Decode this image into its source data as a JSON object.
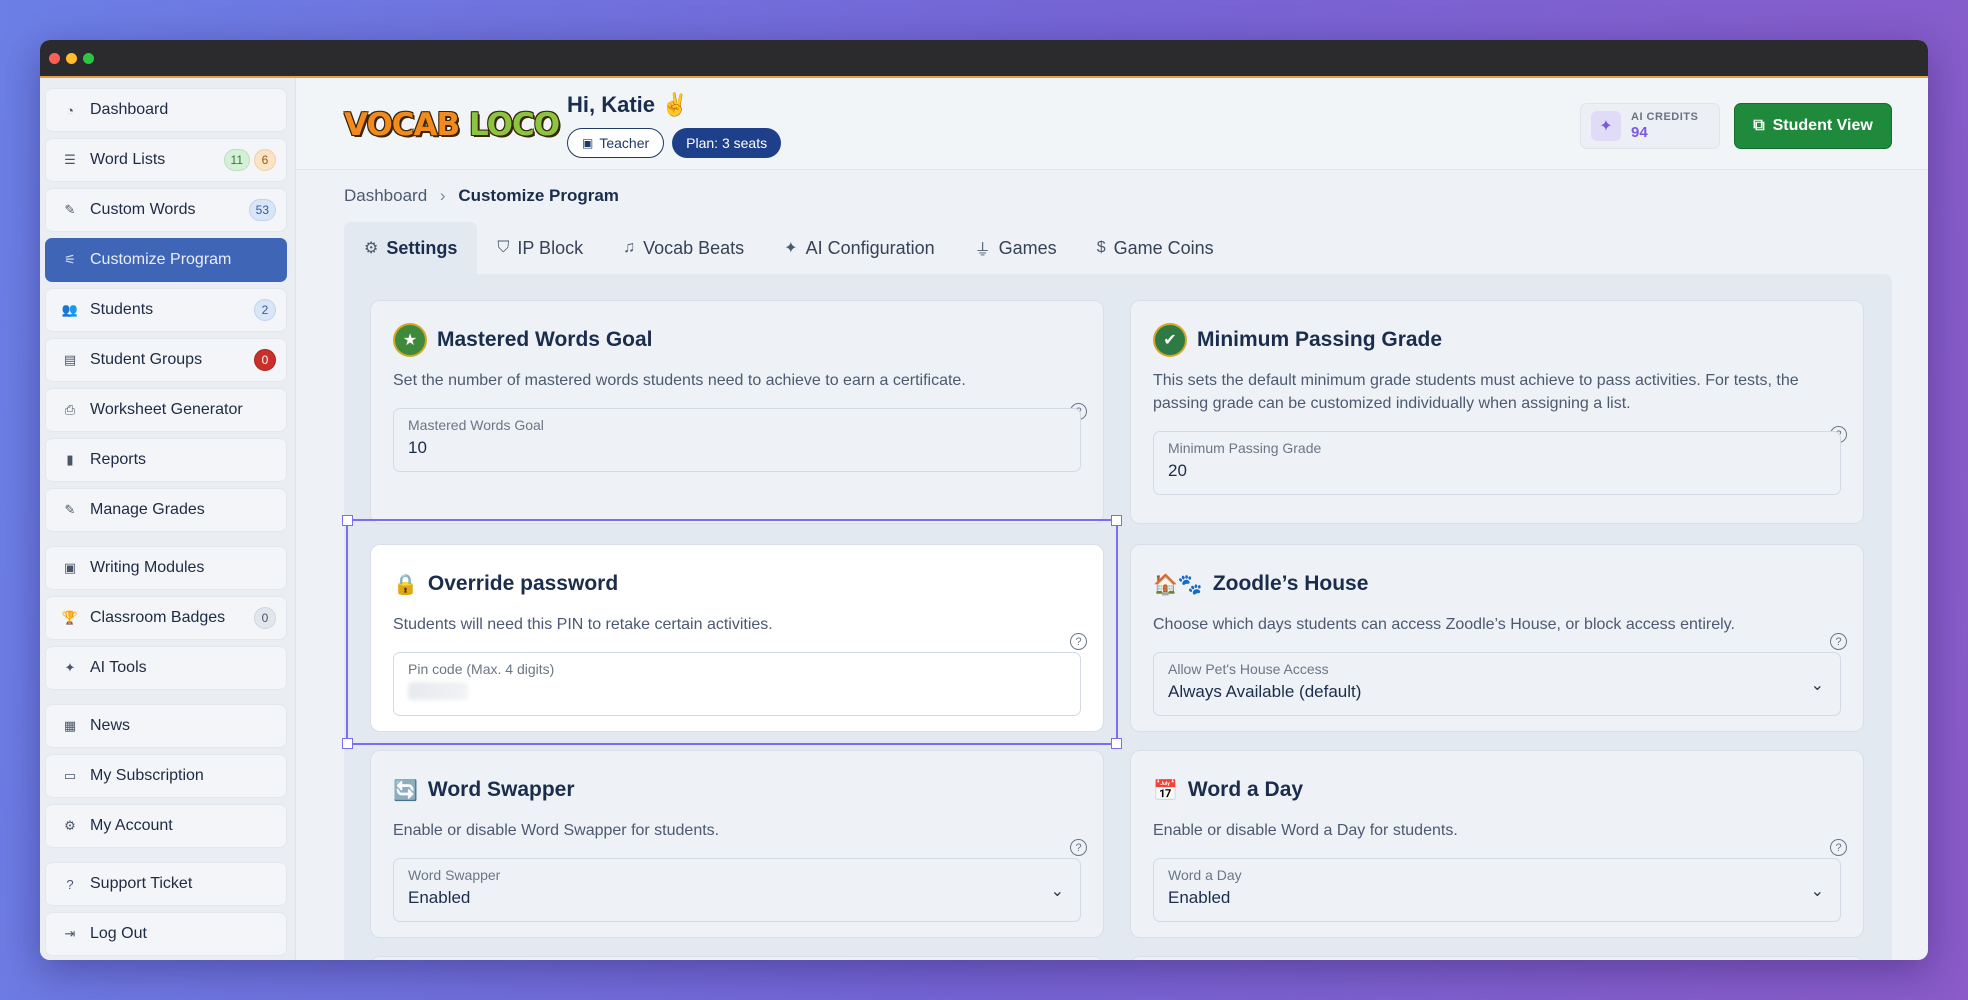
{
  "sidebar": {
    "items": [
      {
        "label": "Dashboard",
        "icon": "gauge-icon"
      },
      {
        "label": "Word Lists",
        "icon": "list-icon",
        "badges": [
          "11",
          "6"
        ]
      },
      {
        "label": "Custom Words",
        "icon": "edit-icon",
        "badges": [
          "53"
        ]
      },
      {
        "label": "Customize Program",
        "icon": "sliders-icon"
      },
      {
        "label": "Students",
        "icon": "users-icon",
        "badges": [
          "2"
        ]
      },
      {
        "label": "Student Groups",
        "icon": "folder-icon",
        "badges": [
          "0"
        ]
      },
      {
        "label": "Worksheet Generator",
        "icon": "printer-icon"
      },
      {
        "label": "Reports",
        "icon": "bar-chart-icon"
      },
      {
        "label": "Manage Grades",
        "icon": "edit-icon"
      },
      {
        "label": "Writing Modules",
        "icon": "image-icon"
      },
      {
        "label": "Classroom Badges",
        "icon": "trophy-icon",
        "badges": [
          "0"
        ]
      },
      {
        "label": "AI Tools",
        "icon": "sparkle-icon"
      },
      {
        "label": "News",
        "icon": "newspaper-icon"
      },
      {
        "label": "My Subscription",
        "icon": "credit-card-icon"
      },
      {
        "label": "My Account",
        "icon": "gear-icon"
      },
      {
        "label": "Support Ticket",
        "icon": "question-icon"
      },
      {
        "label": "Log Out",
        "icon": "logout-icon"
      }
    ]
  },
  "header": {
    "logo_word1": "VOCAB",
    "logo_word2": "LOCO",
    "greeting": "Hi, Katie ✌️",
    "role": "Teacher",
    "plan": "Plan: 3 seats",
    "credits_label": "AI CREDITS",
    "credits_value": "94",
    "student_view": "Student View"
  },
  "breadcrumb": {
    "root": "Dashboard",
    "sep": "›",
    "current": "Customize Program"
  },
  "tabs": [
    {
      "label": "Settings",
      "icon": "gear-icon",
      "active": true
    },
    {
      "label": "IP Block",
      "icon": "shield-icon"
    },
    {
      "label": "Vocab Beats",
      "icon": "music-note-icon"
    },
    {
      "label": "AI Configuration",
      "icon": "sparkle-icon"
    },
    {
      "label": "Games",
      "icon": "joystick-icon"
    },
    {
      "label": "Game Coins",
      "icon": "coin-icon"
    }
  ],
  "cards": {
    "mastered": {
      "title": "Mastered Words Goal",
      "desc": "Set the number of mastered words students need to achieve to earn a certificate.",
      "field_label": "Mastered Words Goal",
      "field_value": "10"
    },
    "passing": {
      "title": "Minimum Passing Grade",
      "desc": "This sets the default minimum grade students must achieve to pass activities. For tests, the passing grade can be customized individually when assigning a list.",
      "field_label": "Minimum Passing Grade",
      "field_value": "20"
    },
    "override": {
      "emoji": "🔒",
      "title": "Override password",
      "desc": "Students will need this PIN to retake certain activities.",
      "field_label": "Pin code (Max. 4 digits)"
    },
    "zoodle": {
      "emoji": "🏠🐾",
      "title": "Zoodle’s House",
      "desc": "Choose which days students can access Zoodle’s House, or block access entirely.",
      "field_label": "Allow Pet's House Access",
      "field_value": "Always Available (default)"
    },
    "swapper": {
      "emoji": "🔄",
      "title": "Word Swapper",
      "desc": "Enable or disable Word Swapper for students.",
      "field_label": "Word Swapper",
      "field_value": "Enabled"
    },
    "wordday": {
      "emoji": "📅",
      "title": "Word a Day",
      "desc": "Enable or disable Word a Day for students.",
      "field_label": "Word a Day",
      "field_value": "Enabled"
    }
  }
}
